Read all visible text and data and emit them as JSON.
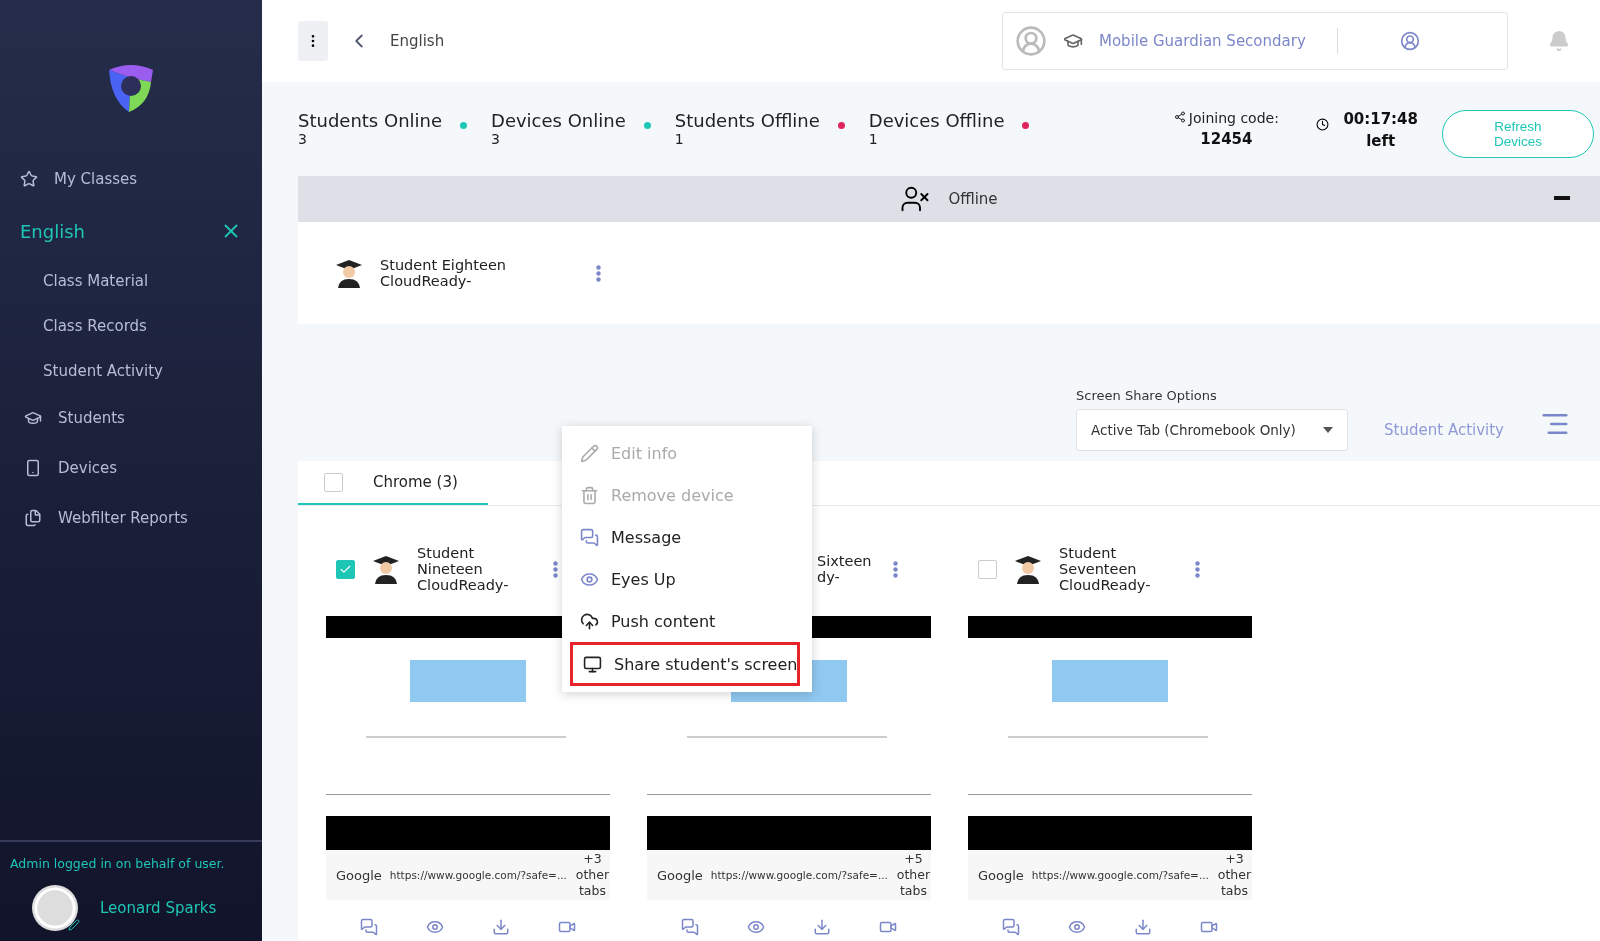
{
  "sidebar": {
    "nav": [
      {
        "kind": "classes",
        "label": "My Classes"
      },
      {
        "kind": "class",
        "label": "English",
        "expanded": true,
        "children": [
          {
            "label": "Class Material"
          },
          {
            "label": "Class Records"
          },
          {
            "label": "Student Activity"
          }
        ]
      },
      {
        "kind": "students",
        "label": "Students"
      },
      {
        "kind": "devices",
        "label": "Devices"
      },
      {
        "kind": "reports",
        "label": "Webfilter Reports"
      }
    ],
    "admin_note": "Admin logged in on behalf of user.",
    "user": "Leonard Sparks"
  },
  "topbar": {
    "title": "English",
    "school": "Mobile Guardian Secondary"
  },
  "stats": [
    {
      "label": "Students Online",
      "value": "3",
      "color": "#1ec6b6"
    },
    {
      "label": "Devices Online",
      "value": "3",
      "color": "#1ec6b6"
    },
    {
      "label": "Students Offline",
      "value": "1",
      "color": "#e0245e"
    },
    {
      "label": "Devices Offline",
      "value": "1",
      "color": "#e0245e"
    }
  ],
  "joining": {
    "label": "Joining code:",
    "code": "12454"
  },
  "timer": {
    "time": "00:17:48",
    "suffix": "left"
  },
  "refresh_button": "Refresh Devices",
  "offline": {
    "title": "Offline",
    "expanded": true,
    "students": [
      {
        "name": "Student Eighteen",
        "device": "CloudReady-"
      }
    ]
  },
  "screen_share": {
    "label": "Screen Share Options",
    "value": "Active Tab (Chromebook Only)"
  },
  "activity_link": "Student Activity",
  "tab": {
    "label": "Chrome (3)",
    "checked": false,
    "selected": true
  },
  "cards": [
    {
      "name": "Student Nineteen",
      "device": "CloudReady-",
      "checked": true,
      "site": "Google",
      "url": "https://www.google.com/?safe=...",
      "other_tabs": "+3 other tabs"
    },
    {
      "name": "Sixteen",
      "device": "dy-",
      "site": "Google",
      "url": "https://www.google.com/?safe=...",
      "other_tabs": "+5 other tabs"
    },
    {
      "name": "Student Seventeen",
      "device": "CloudReady-",
      "checked": false,
      "site": "Google",
      "url": "https://www.google.com/?safe=...",
      "other_tabs": "+3 other tabs"
    }
  ],
  "menu": [
    {
      "kind": "edit",
      "label": "Edit info",
      "disabled": true,
      "outlined": false
    },
    {
      "kind": "trash",
      "label": "Remove device",
      "disabled": true,
      "outlined": false
    },
    {
      "kind": "message",
      "label": "Message",
      "disabled": false,
      "outlined": false
    },
    {
      "kind": "eye",
      "label": "Eyes Up",
      "disabled": false,
      "outlined": false
    },
    {
      "kind": "upload",
      "label": "Push content",
      "disabled": false,
      "outlined": false
    },
    {
      "kind": "screen",
      "label": "Share student's screen",
      "disabled": false,
      "outlined": true
    }
  ]
}
